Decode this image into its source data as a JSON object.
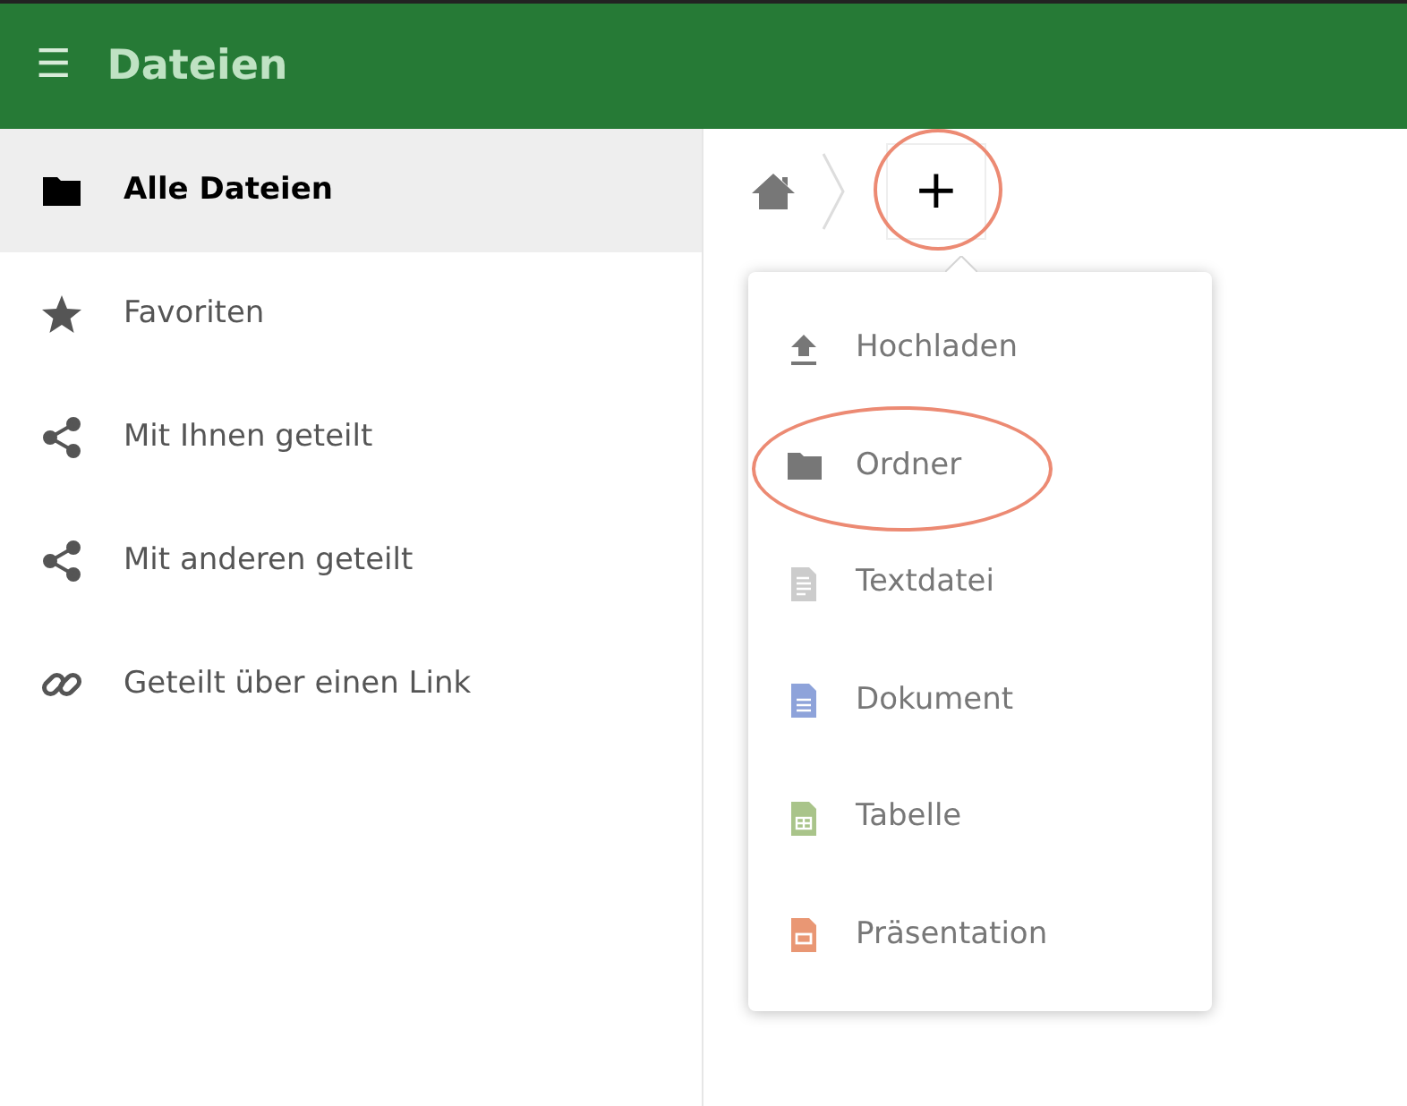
{
  "header": {
    "menu_glyph": "☰",
    "title": "Dateien"
  },
  "sidebar": {
    "items": [
      {
        "label": "Alle Dateien",
        "kind": "folder",
        "selected": true
      },
      {
        "label": "Favoriten",
        "kind": "star",
        "selected": false
      },
      {
        "label": "Mit Ihnen geteilt",
        "kind": "share",
        "selected": false
      },
      {
        "label": "Mit anderen geteilt",
        "kind": "share",
        "selected": false
      },
      {
        "label": "Geteilt über einen Link",
        "kind": "link",
        "selected": false
      }
    ]
  },
  "breadcrumb": {
    "new_button": {
      "label": "+",
      "highlighted": true
    }
  },
  "new_menu": {
    "items": [
      {
        "label": "Hochladen",
        "kind": "upload",
        "highlighted": false
      },
      {
        "label": "Ordner",
        "kind": "folder",
        "highlighted": true
      },
      {
        "label": "Textdatei",
        "kind": "text",
        "highlighted": false
      },
      {
        "label": "Dokument",
        "kind": "document",
        "highlighted": false
      },
      {
        "label": "Tabelle",
        "kind": "spreadsheet",
        "highlighted": false
      },
      {
        "label": "Präsentation",
        "kind": "presentation",
        "highlighted": false
      }
    ]
  }
}
